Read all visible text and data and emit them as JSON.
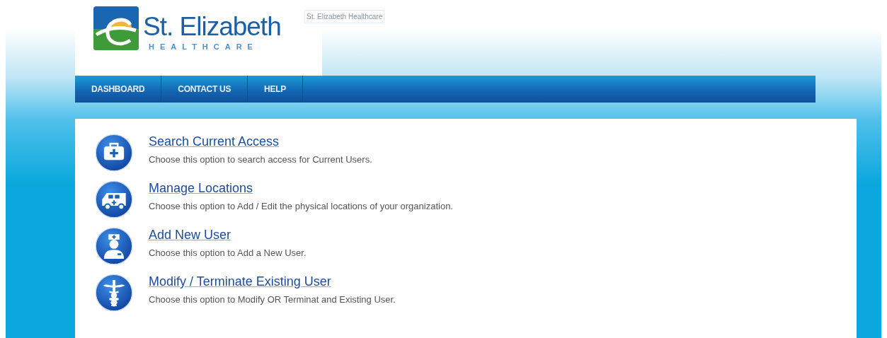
{
  "logo": {
    "name": "St. Elizabeth",
    "tagline": "HEALTHCARE",
    "alt_text": "St. Elizabeth Healthcare"
  },
  "nav": [
    {
      "label": "DASHBOARD"
    },
    {
      "label": "CONTACT US"
    },
    {
      "label": "HELP"
    }
  ],
  "options": [
    {
      "kind": "medkit",
      "title": "Search Current Access",
      "description": "Choose this option to search access for Current Users."
    },
    {
      "kind": "ambulance",
      "title": "Manage Locations",
      "description": "Choose this option to Add / Edit the physical locations of your organization."
    },
    {
      "kind": "doctor",
      "title": "Add New User",
      "description": "Choose this option to Add a New User."
    },
    {
      "kind": "caduceus",
      "title": "Modify / Terminate Existing User",
      "description": "Choose this option to Modify OR Terminat and Existing User."
    }
  ]
}
